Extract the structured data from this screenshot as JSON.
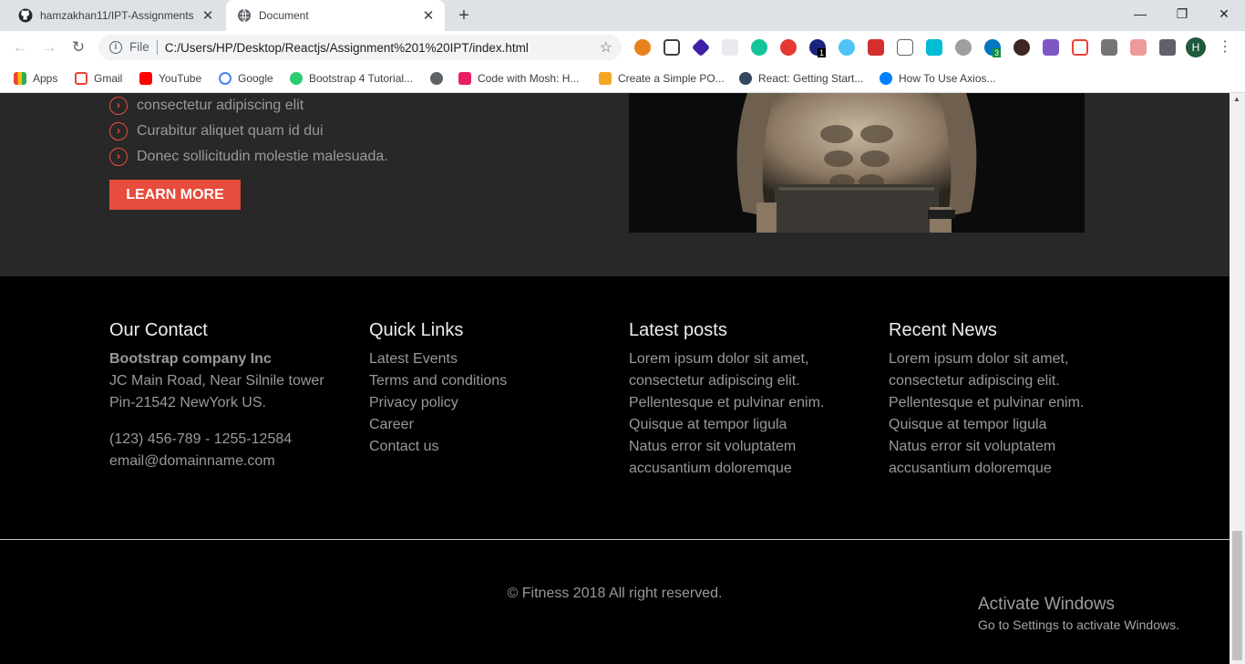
{
  "browser": {
    "tabs": [
      {
        "title": "hamzakhan11/IPT-Assignments",
        "icon": "github-icon"
      },
      {
        "title": "Document",
        "icon": "globe-icon"
      }
    ],
    "address": {
      "scheme_label": "File",
      "url": "C:/Users/HP/Desktop/Reactjs/Assignment%201%20IPT/index.html"
    },
    "avatar_letter": "H",
    "ext_badges": [
      "1",
      "3"
    ],
    "bookmarks": [
      {
        "label": "Apps",
        "icon": "apps-grid-icon",
        "color": "#4285f4"
      },
      {
        "label": "Gmail",
        "icon": "gmail-icon",
        "color": "#ea4335"
      },
      {
        "label": "YouTube",
        "icon": "youtube-icon",
        "color": "#ff0000"
      },
      {
        "label": "Google",
        "icon": "google-icon",
        "color": "#4285f4"
      },
      {
        "label": "Bootstrap 4 Tutorial...",
        "icon": "bootstrap-tutorial-icon",
        "color": "#2ecc71"
      },
      {
        "label": "",
        "icon": "globe-icon",
        "color": "#5f6368"
      },
      {
        "label": "Code with Mosh: H...",
        "icon": "mosh-icon",
        "color": "#e91e63"
      },
      {
        "label": "Create a Simple PO...",
        "icon": "s-logo-icon",
        "color": "#f5a623"
      },
      {
        "label": "React: Getting Start...",
        "icon": "dc-icon",
        "color": "#34495e"
      },
      {
        "label": "How To Use Axios...",
        "icon": "digitalocean-icon",
        "color": "#0080ff"
      }
    ]
  },
  "about": {
    "bullets": [
      "consectetur adipiscing elit",
      "Curabitur aliquet quam id dui",
      "Donec sollicitudin molestie malesuada."
    ],
    "learn_more": "LEARN MORE"
  },
  "footer": {
    "contact": {
      "heading": "Our Contact",
      "company": "Bootstrap company Inc",
      "address1": "JC Main Road, Near Silnile tower",
      "address2": "Pin-21542 NewYork US.",
      "phone": "(123) 456-789 - 1255-12584",
      "email": "email@domainname.com"
    },
    "quick_links": {
      "heading": "Quick Links",
      "items": [
        "Latest Events",
        "Terms and conditions",
        "Privacy policy",
        "Career",
        "Contact us"
      ]
    },
    "latest_posts": {
      "heading": "Latest posts",
      "lines": [
        "Lorem ipsum dolor sit amet,",
        "consectetur adipiscing elit.",
        "Pellentesque et pulvinar enim.",
        "Quisque at tempor ligula",
        "Natus error sit voluptatem",
        "accusantium doloremque"
      ]
    },
    "recent_news": {
      "heading": "Recent News",
      "lines": [
        "Lorem ipsum dolor sit amet,",
        "consectetur adipiscing elit.",
        "Pellentesque et pulvinar enim.",
        "Quisque at tempor ligula",
        "Natus error sit voluptatem",
        "accusantium doloremque"
      ]
    },
    "copyright": "© Fitness 2018 All right reserved."
  },
  "watermark": {
    "title": "Activate Windows",
    "subtitle": "Go to Settings to activate Windows."
  },
  "colors": {
    "accent": "#e74c3c",
    "about_bg": "#282828",
    "footer_bg": "#000000",
    "text_muted": "#999999"
  }
}
